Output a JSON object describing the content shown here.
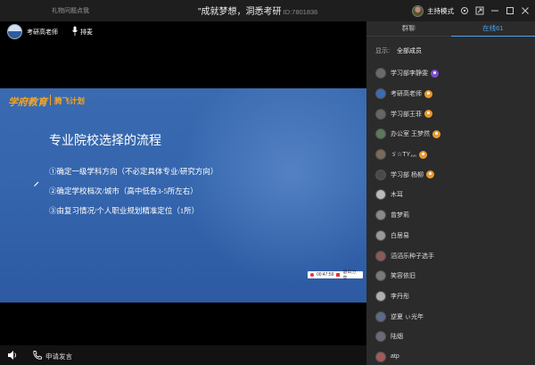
{
  "titlebar": {
    "left_text": "礼物问题点我",
    "title": "\"成就梦想，洞悉考研",
    "room_id": "ID:7801836",
    "host_mode": "主持模式"
  },
  "teacher": {
    "name": "考研高老师",
    "queue_label": "排麦"
  },
  "slide": {
    "logo_text": "学府教育",
    "plan_text": "腾飞计划",
    "title": "专业院校选择的流程",
    "lines": [
      "①确定一级学科方向（不必定具体专业/研究方向）",
      "②确定学校档次/城市（高中低各3-5所左右）",
      "③由复习情况/个人职业规划精准定位（1所）"
    ],
    "rec_time": "00:47:59",
    "rec_stop": "退出分享"
  },
  "bottombar": {
    "apply_label": "申请发言"
  },
  "panel": {
    "tab_chat": "群聊",
    "tab_online": "在线61",
    "filter_label": "显示:",
    "filter_value": "全部成员",
    "users": [
      {
        "name": "学习部李静雯",
        "badge": "purple",
        "avatar": "#6a6a6a"
      },
      {
        "name": "考研高老师",
        "badge": "orange",
        "avatar": "#3b6bb0"
      },
      {
        "name": "学习部王菲",
        "badge": "orange",
        "avatar": "#666"
      },
      {
        "name": "办公室 王梦然",
        "badge": "orange",
        "avatar": "#5a7a5a"
      },
      {
        "name": "ゞ☆TY灬",
        "badge": "orange",
        "avatar": "#7a6a5a"
      },
      {
        "name": "学习部 杨柳",
        "badge": "orange",
        "avatar": "#4a4a4a"
      },
      {
        "name": "木耳",
        "badge": "",
        "avatar": "#bbbbbb"
      },
      {
        "name": "曾梦莉",
        "badge": "",
        "avatar": "#8a8a8a"
      },
      {
        "name": "白居易",
        "badge": "",
        "avatar": "#999999"
      },
      {
        "name": "滔滔乐种子选手",
        "badge": "",
        "avatar": "#8a5a5a"
      },
      {
        "name": "笑容依旧",
        "badge": "",
        "avatar": "#7a7a7a"
      },
      {
        "name": "李丹彤",
        "badge": "",
        "avatar": "#b0b0b0"
      },
      {
        "name": "逆夏 ぃ光年",
        "badge": "",
        "avatar": "#5a6a8a"
      },
      {
        "name": "陆烟",
        "badge": "",
        "avatar": "#6a6a7a"
      },
      {
        "name": "atp",
        "badge": "",
        "avatar": "#a05a5a"
      }
    ]
  }
}
